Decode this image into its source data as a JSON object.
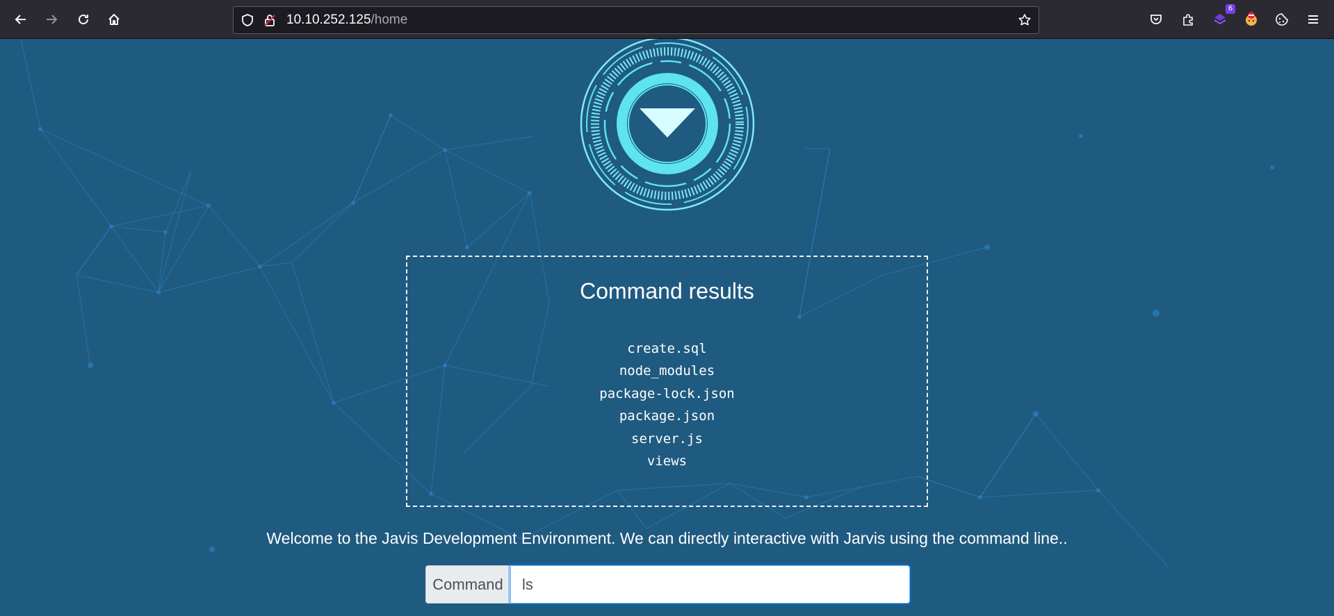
{
  "browser": {
    "url_host": "10.10.252.125",
    "url_path": "/home",
    "extension_badge": "6",
    "icons": [
      "back-arrow-icon",
      "forward-arrow-icon",
      "reload-icon",
      "home-icon",
      "shield-icon",
      "insecure-lock-icon",
      "star-icon",
      "pocket-icon",
      "extensions-icon",
      "extension-stack-icon",
      "extension-avatar-icon",
      "cookie-icon",
      "hamburger-menu-icon"
    ]
  },
  "page": {
    "results_title": "Command results",
    "results": [
      "create.sql",
      "node_modules",
      "package-lock.json",
      "package.json",
      "server.js",
      "views"
    ],
    "welcome": "Welcome to the Javis Development Environment. We can directly interactive with Jarvis using the command line..",
    "command_label": "Command",
    "command_value": "ls"
  },
  "colors": {
    "page_background": "#1f5a80",
    "network_lines": "#2a7fc0",
    "logo_cyan": "#5ee3f0",
    "toolbar": "#2b2a33"
  }
}
